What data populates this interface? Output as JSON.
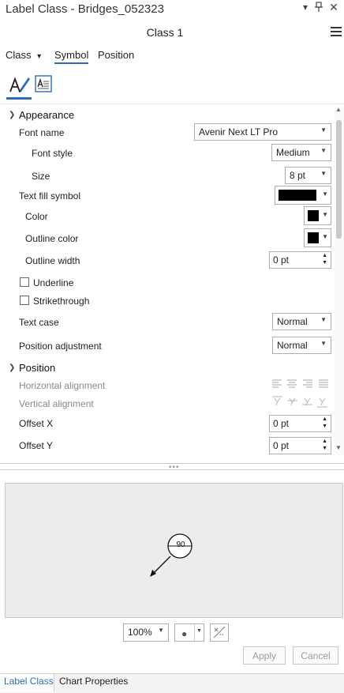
{
  "window": {
    "title": "Label Class - Bridges_052323",
    "dropdown_icon": "chevron-down-icon",
    "pin_icon": "pin-icon",
    "close_icon": "close-icon"
  },
  "header": {
    "class_name": "Class 1",
    "menu_icon": "hamburger-icon"
  },
  "tabs": {
    "class_label": "Class",
    "symbol_label": "Symbol",
    "position_label": "Position",
    "active": "Symbol"
  },
  "subtabs": [
    {
      "icon": "text-symbol-icon",
      "active": true
    },
    {
      "icon": "text-format-icon",
      "active": false
    }
  ],
  "appearance": {
    "header": "Appearance",
    "font_name_label": "Font name",
    "font_name_value": "Avenir Next LT Pro",
    "font_style_label": "Font style",
    "font_style_value": "Medium",
    "size_label": "Size",
    "size_value": "8 pt",
    "text_fill_label": "Text fill symbol",
    "color_label": "Color",
    "outline_color_label": "Outline color",
    "outline_width_label": "Outline width",
    "outline_width_value": "0 pt",
    "underline_label": "Underline",
    "underline_checked": false,
    "strikethrough_label": "Strikethrough",
    "strikethrough_checked": false,
    "text_case_label": "Text case",
    "text_case_value": "Normal",
    "position_adjustment_label": "Position adjustment",
    "position_adjustment_value": "Normal"
  },
  "position": {
    "header": "Position",
    "horizontal_alignment_label": "Horizontal alignment",
    "vertical_alignment_label": "Vertical alignment",
    "offset_x_label": "Offset X",
    "offset_x_value": "0 pt",
    "offset_y_label": "Offset Y",
    "offset_y_value": "0 pt"
  },
  "preview": {
    "label_text": "90"
  },
  "controls": {
    "zoom_value": "100%",
    "point_icon": "point-icon",
    "reset_icon": "no-symbol-icon",
    "apply_label": "Apply",
    "cancel_label": "Cancel"
  },
  "bottom_tabs": {
    "label_class": "Label Class",
    "chart_properties": "Chart Properties",
    "active": "Label Class"
  },
  "colors": {
    "accent": "#2a6fb5",
    "fill_swatch": "#000000",
    "preview_bg": "#ececec"
  }
}
